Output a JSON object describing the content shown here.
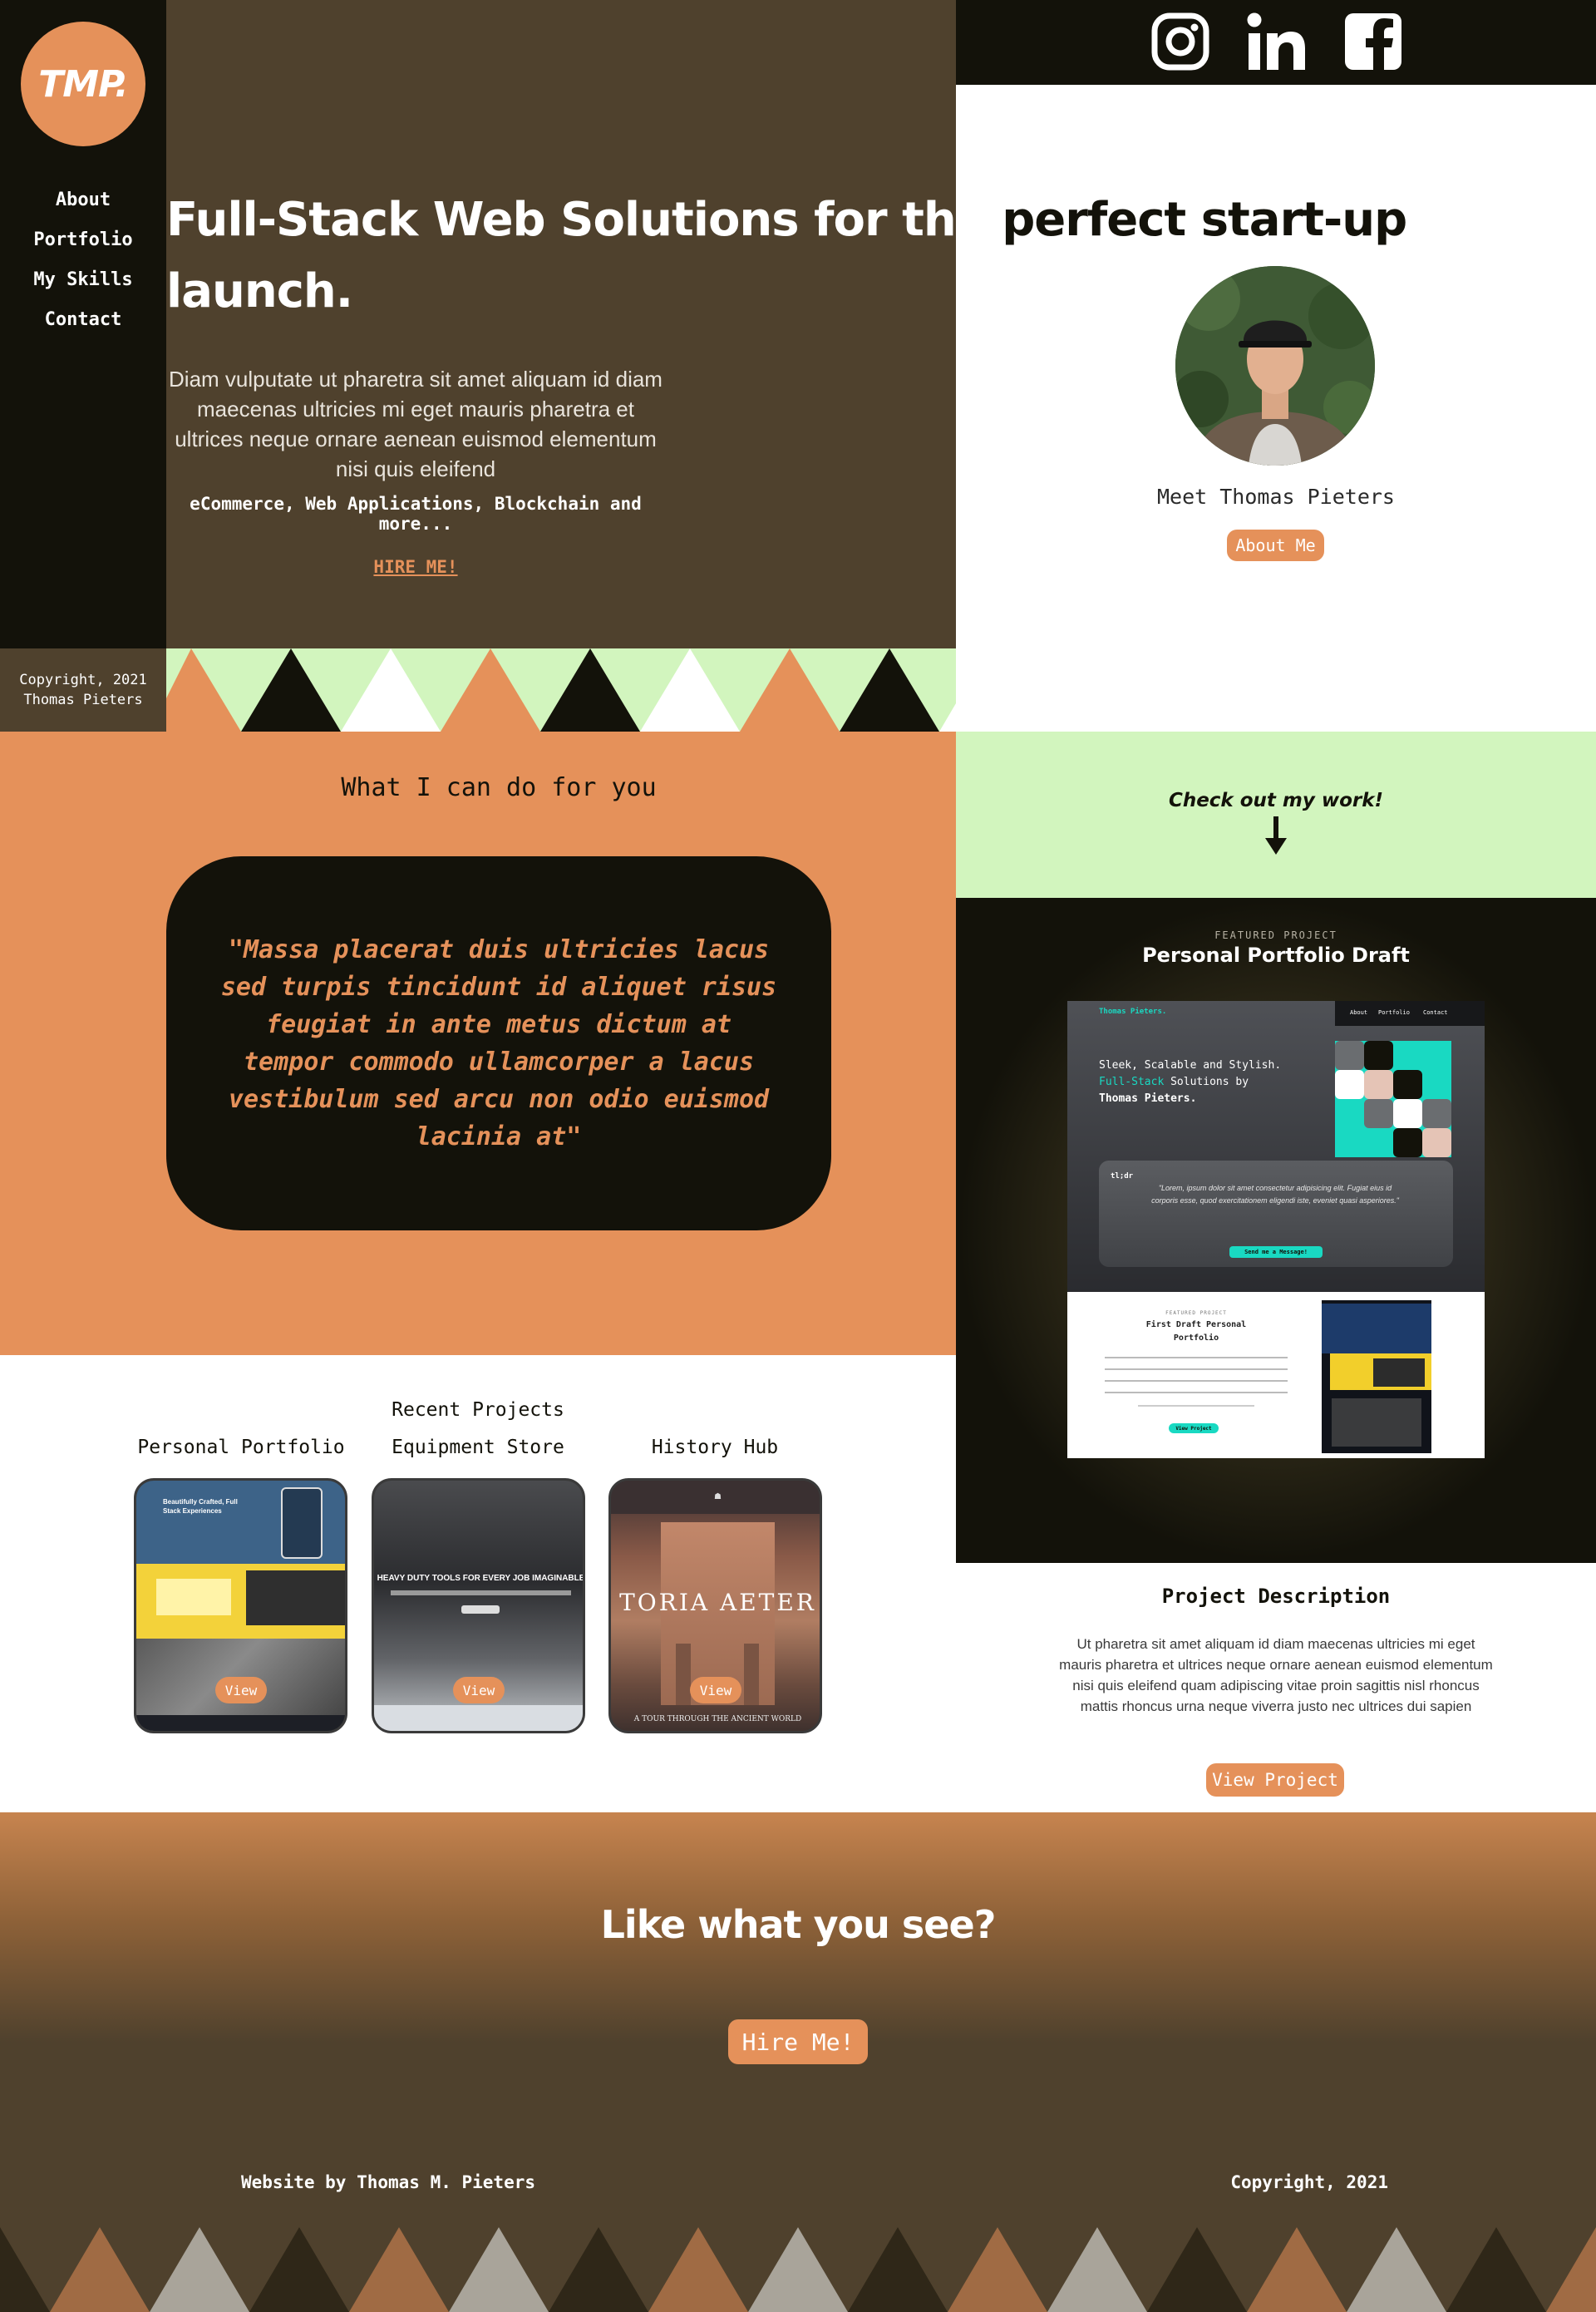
{
  "brand": {
    "logo_text": "TMP."
  },
  "sidebar": {
    "nav": [
      {
        "label": "About"
      },
      {
        "label": "Portfolio"
      },
      {
        "label": "My Skills"
      },
      {
        "label": "Contact"
      }
    ],
    "copyright_line1": "Copyright, 2021",
    "copyright_line2": "Thomas Pieters"
  },
  "social": {
    "icons": [
      "instagram-icon",
      "linkedin-icon",
      "facebook-icon"
    ]
  },
  "hero": {
    "title_line1_part1": "Full-Stack Web Solutions for the",
    "title_line1_part2": "perfect start-up",
    "title_line2": "launch.",
    "description": "Diam vulputate ut pharetra sit amet aliquam id diam maecenas ultricies mi eget mauris pharetra et ultrices neque ornare aenean euismod elementum nisi quis eleifend",
    "services": "eCommerce, Web Applications, Blockchain and more...",
    "hire_label": "HIRE ME!"
  },
  "profile": {
    "meet_text": "Meet Thomas Pieters",
    "about_button": "About Me"
  },
  "services": {
    "title": "What I can do for you",
    "quote": "\"Massa placerat duis ultricies lacus sed turpis tincidunt id aliquet risus feugiat in ante metus dictum at tempor commodo ullamcorper a lacus vestibulum sed arcu non odio euismod lacinia at\""
  },
  "checkout": {
    "text": "Check out my work!"
  },
  "featured": {
    "label": "FEATURED PROJECT",
    "title": "Personal Portfolio Draft",
    "mock": {
      "brand": "Thomas Pieters.",
      "nav": [
        "About",
        "Portfolio",
        "Contact"
      ],
      "headline_1": "Sleek, Scalable and Stylish.",
      "headline_2a": "Full-Stack",
      "headline_2b": " Solutions by",
      "headline_3": "Thomas Pieters.",
      "tldr": "tl;dr",
      "quote": "\"Lorem, ipsum dolor sit amet consectetur adipisicing elit. Fugiat eius id corporis esse, quod exercitationem eligendi iste, eveniet quasi asperiores.\"",
      "send_button": "Send me a Message!",
      "sub_label": "FEATURED PROJECT",
      "sub_title_1": "First Draft Personal",
      "sub_title_2": "Portfolio",
      "sub_button": "View Project"
    }
  },
  "recent": {
    "title": "Recent Projects",
    "projects": [
      {
        "name": "Personal Portfolio",
        "view": "View",
        "preview_headline": "Beautifully Crafted, Full Stack Experiences"
      },
      {
        "name": "Equipment Store",
        "view": "View",
        "preview_headline": "HEAVY DUTY TOOLS FOR EVERY JOB IMAGINABLE"
      },
      {
        "name": "History Hub",
        "view": "View",
        "preview_headline": "TORIA AETER",
        "preview_sub": "A TOUR THROUGH THE ANCIENT WORLD"
      }
    ]
  },
  "project_description": {
    "title": "Project Description",
    "text": "Ut pharetra sit amet aliquam id diam maecenas ultricies mi eget mauris pharetra et ultrices neque ornare aenean euismod elementum nisi quis eleifend quam adipiscing vitae proin sagittis nisl rhoncus mattis rhoncus urna neque viverra justo nec ultrices dui sapien",
    "button": "View Project"
  },
  "footer": {
    "headline": "Like what you see?",
    "hire_button": "Hire Me!",
    "credit": "Website by Thomas M. Pieters",
    "copyright": "Copyright, 2021"
  },
  "colors": {
    "accent": "#e5915a",
    "dark": "#13120a",
    "brown": "#4f412d",
    "mint": "#d2f5be",
    "teal": "#19d9c2"
  }
}
